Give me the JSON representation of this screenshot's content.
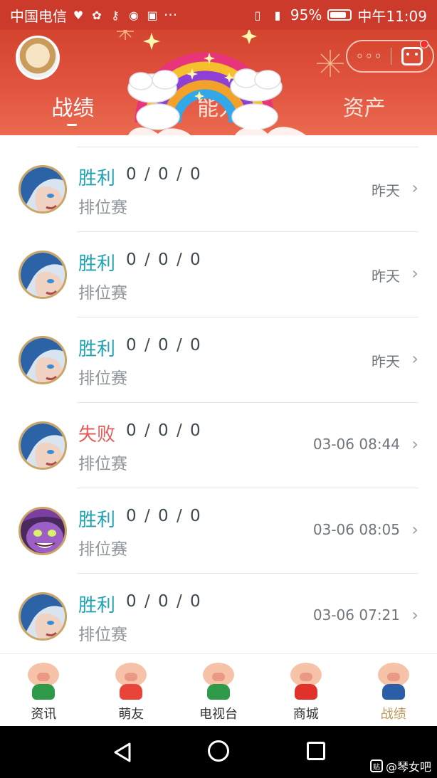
{
  "status_bar": {
    "carrier": "中国电信",
    "battery_text": "95%",
    "time": "中午11:09",
    "dots": "···"
  },
  "header": {
    "pill_dots": "◦◦◦",
    "tabs": [
      {
        "label": "战绩",
        "active": true
      },
      {
        "label": "能力",
        "active": false
      },
      {
        "label": "资产",
        "active": false
      }
    ]
  },
  "matches": [
    {
      "result": "胜利",
      "outcome": "win",
      "kda": "0 / 0 / 0",
      "mode": "排位赛",
      "time": "昨天",
      "hero": "blue-hair-hero"
    },
    {
      "result": "胜利",
      "outcome": "win",
      "kda": "0 / 0 / 0",
      "mode": "排位赛",
      "time": "昨天",
      "hero": "blue-hair-hero"
    },
    {
      "result": "胜利",
      "outcome": "win",
      "kda": "0 / 0 / 0",
      "mode": "排位赛",
      "time": "昨天",
      "hero": "blue-hair-hero"
    },
    {
      "result": "失败",
      "outcome": "lose",
      "kda": "0 / 0 / 0",
      "mode": "排位赛",
      "time": "03-06 08:44",
      "hero": "blue-hair-hero"
    },
    {
      "result": "胜利",
      "outcome": "win",
      "kda": "0 / 0 / 0",
      "mode": "排位赛",
      "time": "03-06 08:05",
      "hero": "purple-yordle-hero"
    },
    {
      "result": "胜利",
      "outcome": "win",
      "kda": "0 / 0 / 0",
      "mode": "排位赛",
      "time": "03-06 07:21",
      "hero": "blue-hair-hero"
    }
  ],
  "bottom_nav": [
    {
      "label": "资讯",
      "active": false
    },
    {
      "label": "萌友",
      "active": false
    },
    {
      "label": "电视台",
      "active": false
    },
    {
      "label": "商城",
      "active": false
    },
    {
      "label": "战绩",
      "active": true
    }
  ],
  "watermark": {
    "text": "@琴女吧"
  },
  "colors": {
    "header_red": "#d4442e",
    "win": "#1fa3b1",
    "lose": "#e35b5b",
    "active_nav": "#b99658"
  }
}
